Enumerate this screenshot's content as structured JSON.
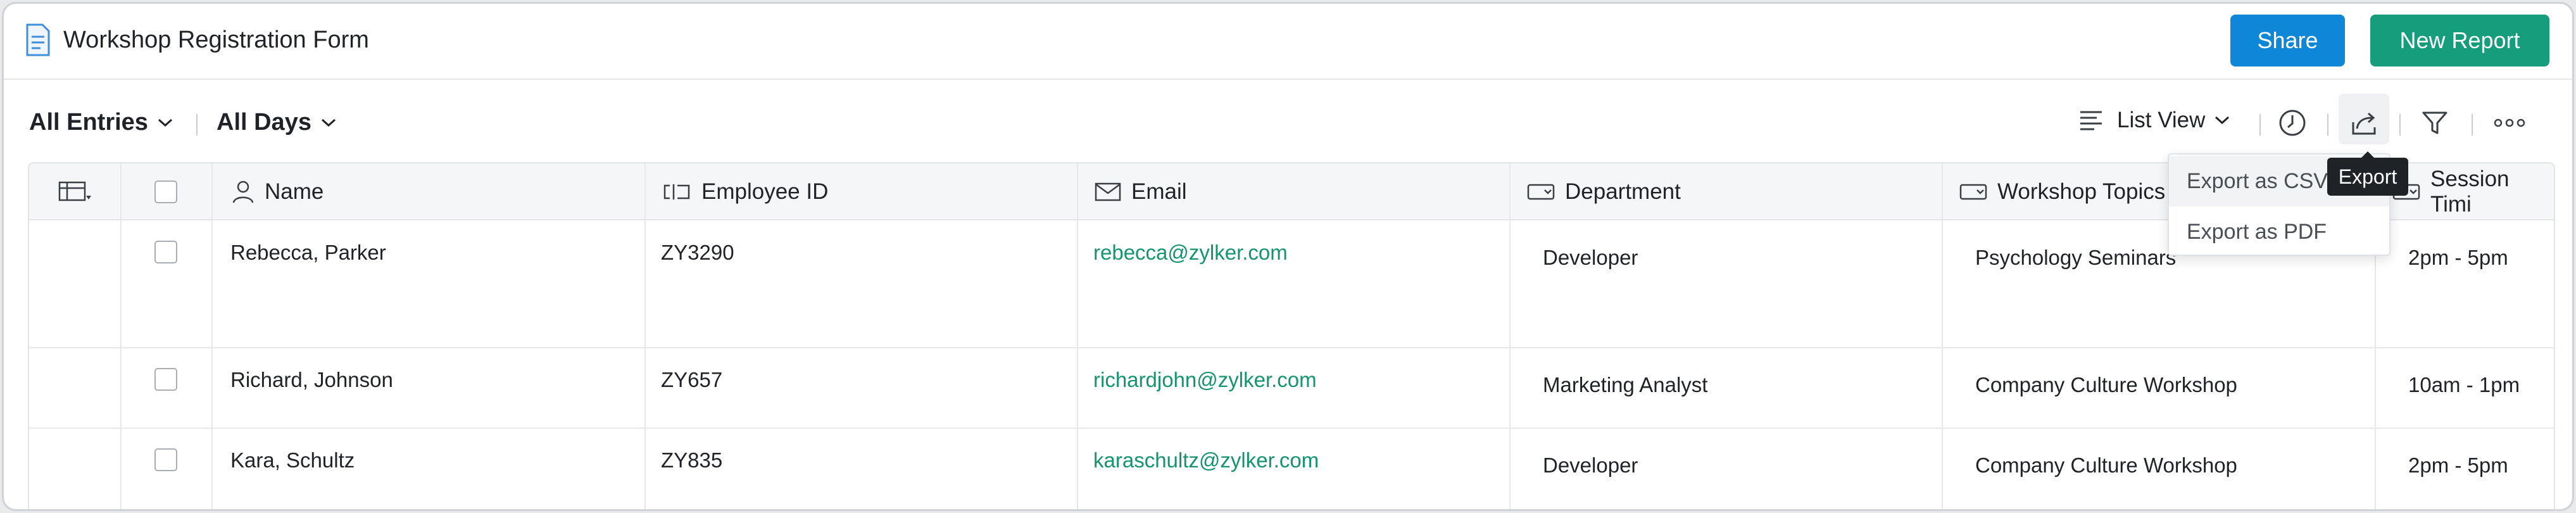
{
  "header": {
    "title": "Workshop Registration Form",
    "share_label": "Share",
    "new_report_label": "New Report"
  },
  "filters": {
    "entries": "All Entries",
    "days": "All Days",
    "view": "List View"
  },
  "toolbar": {
    "icons": [
      "history-icon",
      "export-icon",
      "filter-icon",
      "more-icon"
    ]
  },
  "export_menu": {
    "tooltip": "Export",
    "items": [
      "Export as CSV",
      "Export as PDF"
    ]
  },
  "table": {
    "columns": [
      "Name",
      "Employee ID",
      "Email",
      "Department",
      "Workshop Topics",
      "Session Timi"
    ],
    "rows": [
      [
        "Rebecca, Parker",
        "ZY3290",
        "rebecca@zylker.com",
        "Developer",
        "Psychology Seminars",
        "2pm - 5pm"
      ],
      [
        "Richard, Johnson",
        "ZY657",
        "richardjohn@zylker.com",
        "Marketing Analyst",
        "Company Culture Workshop",
        "10am - 1pm"
      ],
      [
        "Kara, Schultz",
        "ZY835",
        "karaschultz@zylker.com",
        "Developer",
        "Company Culture Workshop",
        "2pm - 5pm"
      ]
    ]
  },
  "colors": {
    "share": "#0e87d8",
    "new_report": "#159d7c",
    "email_link": "#14946f"
  }
}
